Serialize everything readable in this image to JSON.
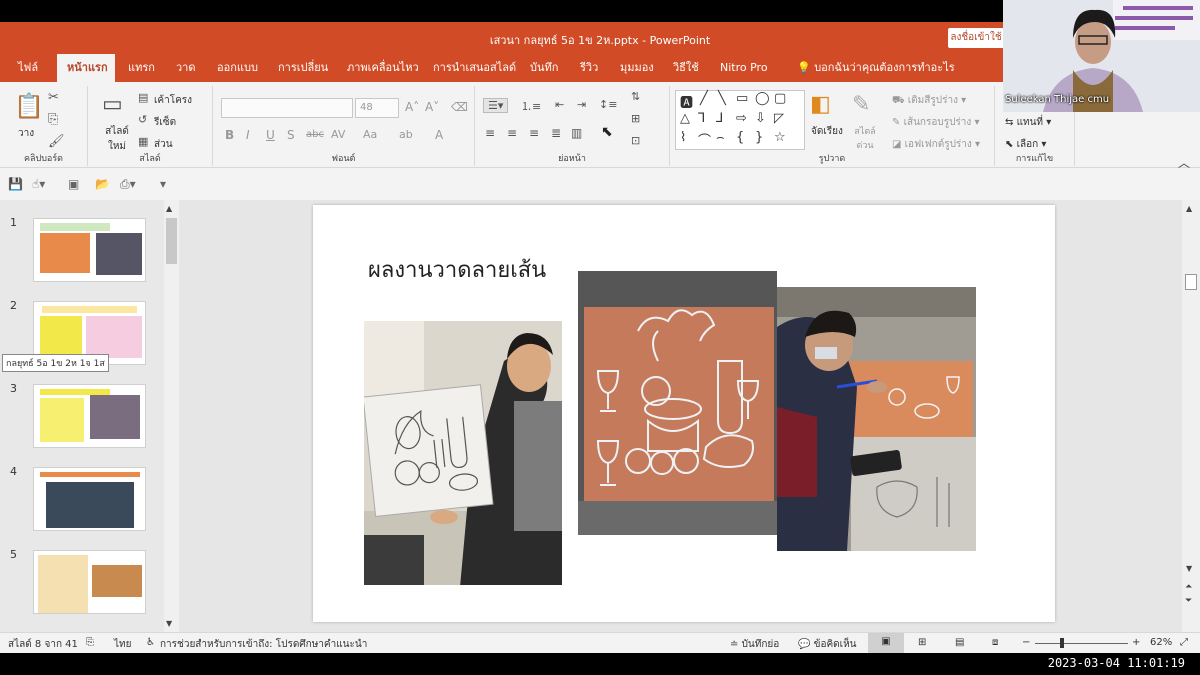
{
  "window": {
    "title": "เสวนา กลยุทธ์ 5อ 1ข 2ห.pptx  -  PowerPoint",
    "signin_label": "ลงชื่อเข้าใช้"
  },
  "tabs": [
    "ไฟล์",
    "หน้าแรก",
    "แทรก",
    "วาด",
    "ออกแบบ",
    "การเปลี่ยน",
    "ภาพเคลื่อนไหว",
    "การนำเสนอสไลด์",
    "บันทึก",
    "รีวิว",
    "มุมมอง",
    "วิธีใช้",
    "Nitro Pro",
    "บอกฉันว่าคุณต้องการทำอะไร"
  ],
  "active_tab": "หน้าแรก",
  "ribbon": {
    "clipboard": {
      "paste_label": "วาง",
      "group_label": "คลิปบอร์ด"
    },
    "slides": {
      "new_slide_label": "สไลด์ใหม่",
      "layout_label": "เค้าโครง",
      "reset_label": "รีเซ็ต",
      "section_label": "ส่วน",
      "group_label": "สไลด์"
    },
    "font": {
      "font_size": "48",
      "group_label": "ฟอนต์"
    },
    "paragraph": {
      "group_label": "ย่อหน้า"
    },
    "drawing": {
      "arrange_label": "จัดเรียง",
      "quick_styles_label": "สไตล์ด่วน",
      "fill_label": "เติมสีรูปร่าง",
      "outline_label": "เส้นกรอบรูปร่าง",
      "effects_label": "เอฟเฟกต์รูปร่าง",
      "group_label": "รูปวาด"
    },
    "editing": {
      "replace_label": "แทนที่",
      "select_label": "เลือก",
      "group_label": "การแก้ไข"
    }
  },
  "slides": [
    {
      "number": "1",
      "title": "กลยุทธ์ 5อ 1ข 2ห 1จ 1ส"
    },
    {
      "number": "2",
      "title": "กลยุทธ์ 5อ 1ข 2ห 1จ"
    },
    {
      "number": "3",
      "title": ""
    },
    {
      "number": "4",
      "title": ""
    },
    {
      "number": "5",
      "title": ""
    }
  ],
  "tooltip": "กลยุทธ์ 5อ 1ข 2ห 1จ 1ส",
  "current_slide": {
    "title": "ผลงานวาดลายเส้น"
  },
  "status": {
    "slide_counter": "สไลด์ 8 จาก 41",
    "language": "ไทย",
    "accessibility": "การช่วยสำหรับการเข้าถึง: โปรดศึกษาคำแนะนำ",
    "notes_label": "บันทึกย่อ",
    "comments_label": "ข้อคิดเห็น",
    "zoom": "62%"
  },
  "video": {
    "participant_name": "Suleekan Thijae cmu"
  },
  "timestamp": "2023-03-04  11:01:19",
  "colors": {
    "accent": "#d04b26",
    "ribbon_bg": "#f3f3f3",
    "canvas_bg": "#e6e6e6"
  }
}
